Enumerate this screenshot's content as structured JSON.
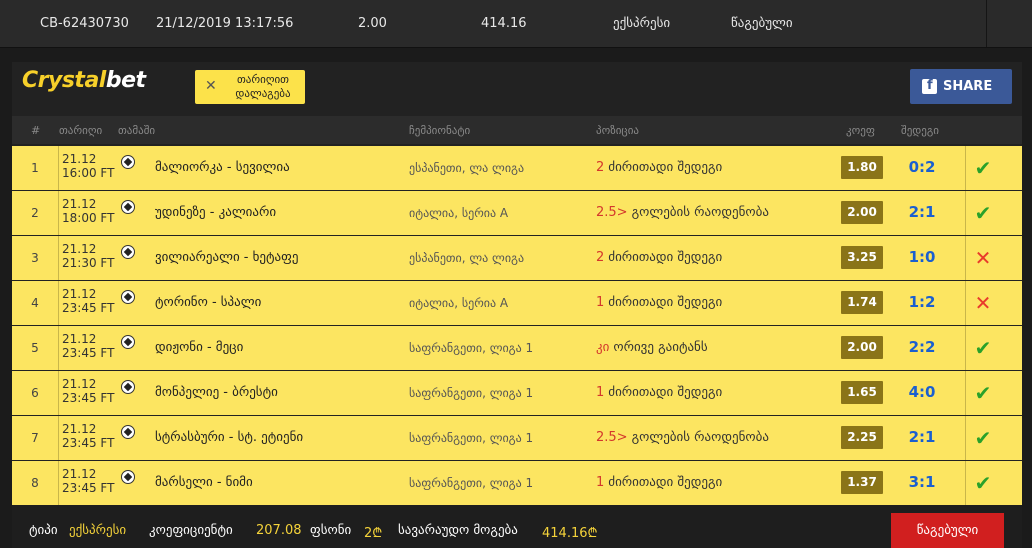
{
  "summary": {
    "id": "CB-62430730",
    "datetime": "21/12/2019 13:17:56",
    "stake": "2.00",
    "payout": "414.16",
    "type": "ექსპრესი",
    "status": "წაგებული"
  },
  "brand": {
    "part1": "Crystal",
    "part2": "bet"
  },
  "clear_button": {
    "icon": "close-icon",
    "line1": "თარიღით",
    "line2": "დალაგება"
  },
  "share_button": {
    "icon": "facebook-icon",
    "label": "SHARE"
  },
  "columns": {
    "num": "#",
    "date": "თარიღი",
    "match": "თამაში",
    "league": "ჩემპიონატი",
    "pick": "პოზიცია",
    "odds": "კოეფ",
    "result": "შედეგი"
  },
  "rows": [
    {
      "num": "1",
      "date": "21.12",
      "time": "16:00 FT",
      "match": "მალიორკა - სევილია",
      "league": "ესპანეთი, ლა ლიგა",
      "pick_code": "2",
      "pick": "ძირითადი შედეგი",
      "odds": "1.80",
      "score": "0:2",
      "outcome": "won"
    },
    {
      "num": "2",
      "date": "21.12",
      "time": "18:00 FT",
      "match": "უდინეზე - კალიარი",
      "league": "იტალია, სერია A",
      "pick_code": "2.5>",
      "pick": "გოლების რაოდენობა",
      "odds": "2.00",
      "score": "2:1",
      "outcome": "won"
    },
    {
      "num": "3",
      "date": "21.12",
      "time": "21:30 FT",
      "match": "ვილიარეალი - ხეტაფე",
      "league": "ესპანეთი, ლა ლიგა",
      "pick_code": "2",
      "pick": "ძირითადი შედეგი",
      "odds": "3.25",
      "score": "1:0",
      "outcome": "lost"
    },
    {
      "num": "4",
      "date": "21.12",
      "time": "23:45 FT",
      "match": "ტორინო - სპალი",
      "league": "იტალია, სერია A",
      "pick_code": "1",
      "pick": "ძირითადი შედეგი",
      "odds": "1.74",
      "score": "1:2",
      "outcome": "lost"
    },
    {
      "num": "5",
      "date": "21.12",
      "time": "23:45 FT",
      "match": "დიჟონი - მეცი",
      "league": "საფრანგეთი, ლიგა 1",
      "pick_code": "კი",
      "pick": "ორივე გაიტანს",
      "odds": "2.00",
      "score": "2:2",
      "outcome": "won"
    },
    {
      "num": "6",
      "date": "21.12",
      "time": "23:45 FT",
      "match": "მონპელიე - ბრესტი",
      "league": "საფრანგეთი, ლიგა 1",
      "pick_code": "1",
      "pick": "ძირითადი შედეგი",
      "odds": "1.65",
      "score": "4:0",
      "outcome": "won"
    },
    {
      "num": "7",
      "date": "21.12",
      "time": "23:45 FT",
      "match": "სტრასბური - სტ. ეტიენი",
      "league": "საფრანგეთი, ლიგა 1",
      "pick_code": "2.5>",
      "pick": "გოლების რაოდენობა",
      "odds": "2.25",
      "score": "2:1",
      "outcome": "won"
    },
    {
      "num": "8",
      "date": "21.12",
      "time": "23:45 FT",
      "match": "მარსელი - ნიმი",
      "league": "საფრანგეთი, ლიგა 1",
      "pick_code": "1",
      "pick": "ძირითადი შედეგი",
      "odds": "1.37",
      "score": "3:1",
      "outcome": "won"
    }
  ],
  "footer": {
    "type_label": "ტიპი",
    "type_value": "ექსპრესი",
    "coef_label": "კოეფიციენტი",
    "coef_value": "207.08",
    "stake_label": "ფსონი",
    "stake_value": "2₾",
    "win_label": "სავარაუდო მოგება",
    "win_value": "414.16₾",
    "status_button": "წაგებული"
  },
  "colors": {
    "row_bg": "#fce561",
    "odds_bg": "#8a7418",
    "score": "#1a5fd0",
    "won": "#2aa12a",
    "lost": "#e83b2b",
    "brand_yellow": "#f7d02a",
    "share_bg": "#3b5998",
    "lost_button": "#d11f1f"
  }
}
